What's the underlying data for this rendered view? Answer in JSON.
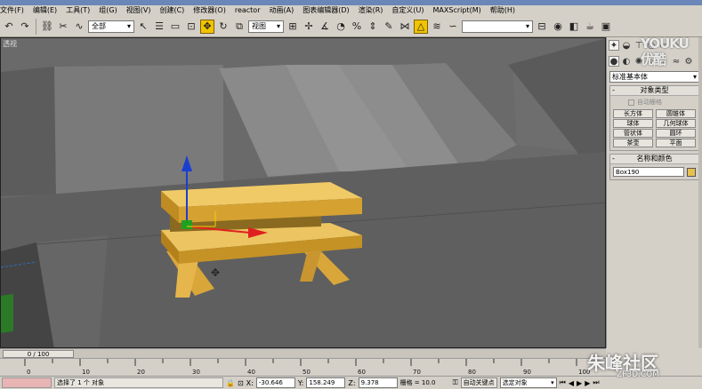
{
  "menu": [
    "文件(F)",
    "编辑(E)",
    "工具(T)",
    "组(G)",
    "视图(V)",
    "创建(C)",
    "修改器(O)",
    "reactor",
    "动画(A)",
    "图表编辑器(D)",
    "渲染(R)",
    "自定义(U)",
    "MAXScript(M)",
    "帮助(H)"
  ],
  "toolbar": {
    "selection_filter": "全部",
    "coord_system": "视图",
    "icons": [
      "undo-icon",
      "redo-icon",
      "link-icon",
      "unlink-icon",
      "bind-icon",
      "select-icon",
      "select-by-name-icon",
      "rect-region-icon",
      "window-crossing-icon",
      "move-icon",
      "rotate-icon",
      "scale-icon",
      "pivot-icon",
      "mirror-icon",
      "align-icon",
      "layer-icon",
      "curve-editor-icon",
      "schematic-icon",
      "material-editor-icon",
      "render-setup-icon",
      "quick-render-icon",
      "render-icon"
    ]
  },
  "viewport": {
    "label": "透视"
  },
  "command_panel": {
    "category": "标准基本体",
    "object_type_title": "对象类型",
    "autogrid_label": "自动栅格",
    "buttons": [
      "长方体",
      "圆锥体",
      "球体",
      "几何球体",
      "管状体",
      "圆环",
      "茶壶",
      "平面"
    ],
    "name_color_title": "名称和颜色",
    "object_name": "Box190",
    "object_color": "#e8c050",
    "rollout_sign": "-"
  },
  "timeline": {
    "frame_label": "0 / 100",
    "ticks": [
      "0",
      "10",
      "20",
      "30",
      "40",
      "50",
      "60",
      "70",
      "80",
      "90",
      "100"
    ]
  },
  "status": {
    "selection_text": "选择了 1 个 对象",
    "x_label": "X:",
    "x_value": "-30.646",
    "y_label": "Y:",
    "y_value": "158.249",
    "z_label": "Z:",
    "z_value": "9.378",
    "grid_text": "栅格 = 10.0",
    "autokey_label": "自动关键点",
    "selected_dropdown": "选定对象"
  },
  "watermarks": {
    "youku": "YOUKU\n优酷",
    "zhufeng": "朱峰社区",
    "zf3d": "ZF3D.COM"
  },
  "colors": {
    "wood": "#e0b040",
    "wood_dark": "#b98a24",
    "gizmo_x": "#e02020",
    "gizmo_y": "#20a020",
    "gizmo_z": "#1a3fd0",
    "active_tool": "#f0c400"
  }
}
